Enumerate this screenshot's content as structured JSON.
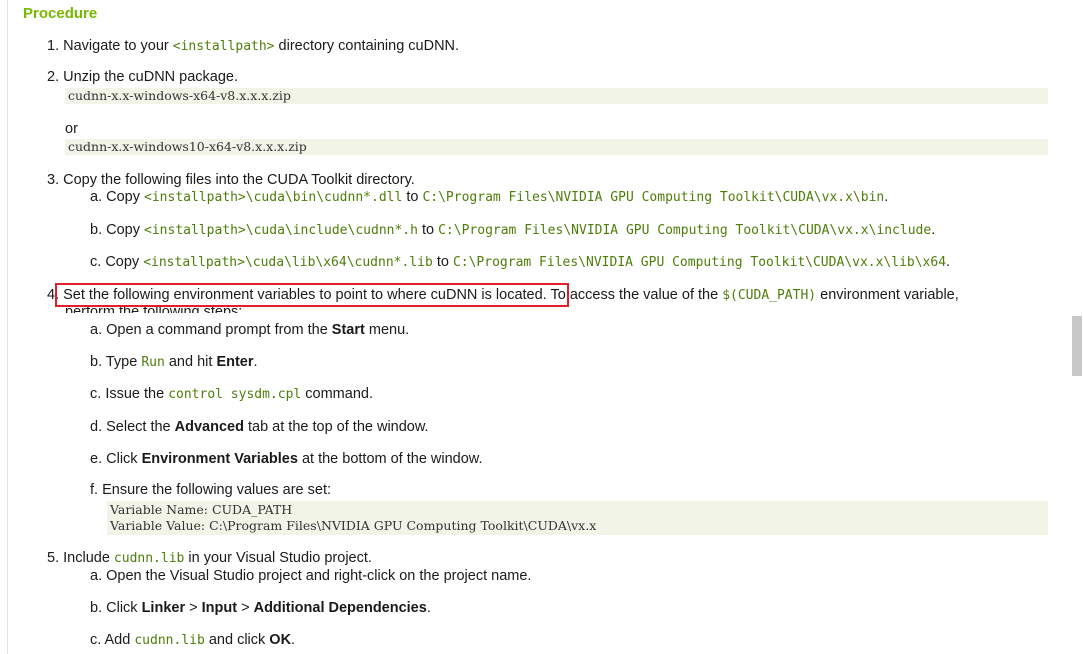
{
  "heading": "Procedure",
  "step1": {
    "num": "1.",
    "pre": "Navigate to your",
    "code": "<installpath>",
    "post": "directory containing cuDNN."
  },
  "step2": {
    "num": "2.",
    "text": "Unzip the cuDNN package.",
    "code1": "cudnn-x.x-windows-x64-v8.x.x.x.zip",
    "or": "or",
    "code2": "cudnn-x.x-windows10-x64-v8.x.x.x.zip"
  },
  "step3": {
    "num": "3.",
    "text": "Copy the following files into the CUDA Toolkit directory.",
    "a": {
      "label": "a.",
      "copy": "Copy",
      "src": "<installpath>\\cuda\\bin\\cudnn*.dll",
      "to": "to",
      "dst": "C:\\Program Files\\NVIDIA GPU Computing Toolkit\\CUDA\\vx.x\\bin",
      "end": "."
    },
    "b": {
      "label": "b.",
      "copy": "Copy",
      "src": "<installpath>\\cuda\\include\\cudnn*.h",
      "to": "to",
      "dst": "C:\\Program Files\\NVIDIA GPU Computing Toolkit\\CUDA\\vx.x\\include",
      "end": "."
    },
    "c": {
      "label": "c.",
      "copy": "Copy",
      "src": "<installpath>\\cuda\\lib\\x64\\cudnn*.lib",
      "to": "to",
      "dst": "C:\\Program Files\\NVIDIA GPU Computing Toolkit\\CUDA\\vx.x\\lib\\x64",
      "end": "."
    }
  },
  "step4": {
    "num": "4.",
    "highlight": "Set the following environment variables to point to where cuDNN is located.",
    "rest1": "To access the value of the",
    "code": "$(CUDA_PATH)",
    "rest2": "environment variable,",
    "line2": "perform the following steps:",
    "a": {
      "label": "a.",
      "pre": "Open a command prompt from the",
      "bold": "Start",
      "post": "menu."
    },
    "b": {
      "label": "b.",
      "pre": "Type",
      "code": "Run",
      "mid": "and hit",
      "bold": "Enter",
      "post": "."
    },
    "c": {
      "label": "c.",
      "pre": "Issue the",
      "code": "control sysdm.cpl",
      "post": "command."
    },
    "d": {
      "label": "d.",
      "pre": "Select the",
      "bold": "Advanced",
      "post": "tab at the top of the window."
    },
    "e": {
      "label": "e.",
      "pre": "Click",
      "bold": "Environment Variables",
      "post": "at the bottom of the window."
    },
    "f": {
      "label": "f.",
      "text": "Ensure the following values are set:",
      "code1": "Variable Name: CUDA_PATH",
      "code2": "Variable Value: C:\\Program Files\\NVIDIA GPU Computing Toolkit\\CUDA\\vx.x"
    }
  },
  "step5": {
    "num": "5.",
    "pre": "Include",
    "code": "cudnn.lib",
    "post": "in your Visual Studio project.",
    "a": {
      "label": "a.",
      "text": "Open the Visual Studio project and right-click on the project name."
    },
    "b": {
      "label": "b.",
      "pre": "Click",
      "bold1": "Linker",
      "sep1": ">",
      "bold2": "Input",
      "sep2": ">",
      "bold3": "Additional Dependencies",
      "post": "."
    },
    "c": {
      "label": "c.",
      "pre": "Add",
      "code": "cudnn.lib",
      "mid": "and click",
      "bold": "OK",
      "post": "."
    }
  }
}
